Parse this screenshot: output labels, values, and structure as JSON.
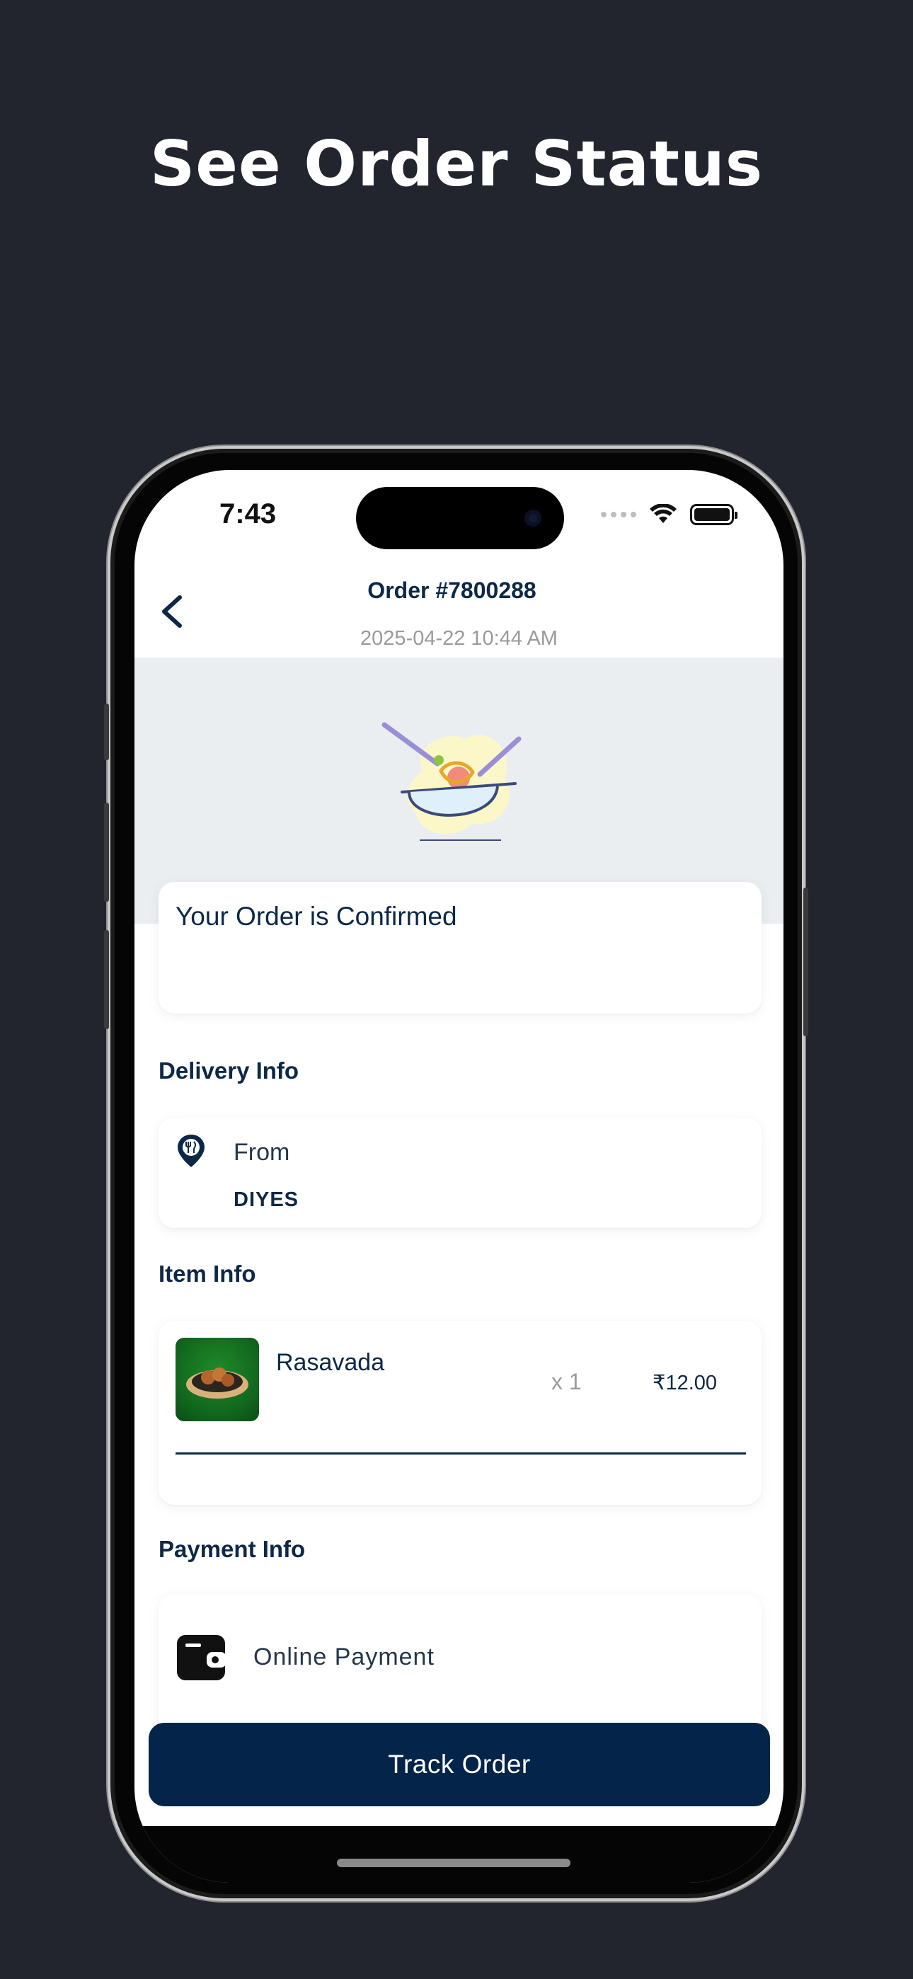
{
  "headline": "See Order Status",
  "status_bar": {
    "time": "7:43",
    "icons": [
      "signal-dots-icon",
      "wifi-icon",
      "battery-icon"
    ]
  },
  "header": {
    "back_icon": "chevron-left-icon",
    "order_title": "Order #7800288",
    "order_date": "2025-04-22 10:44 AM"
  },
  "banner": {
    "illustration": "food-bowl-illustration"
  },
  "status_card": {
    "message": "Your Order is Confirmed"
  },
  "delivery": {
    "section_title": "Delivery Info",
    "icon": "restaurant-pin-icon",
    "from_label": "From",
    "from_value": "DIYES"
  },
  "items": {
    "section_title": "Item Info",
    "list": [
      {
        "name": "Rasavada",
        "quantity": "x 1",
        "price": "₹12.00"
      }
    ]
  },
  "payment": {
    "section_title": "Payment Info",
    "icon": "wallet-icon",
    "method": "Online Payment"
  },
  "actions": {
    "track_order_label": "Track Order"
  },
  "colors": {
    "background": "#22252d",
    "primary": "#04244a",
    "text_primary": "#0d2847",
    "banner_bg": "#ebeef1"
  }
}
